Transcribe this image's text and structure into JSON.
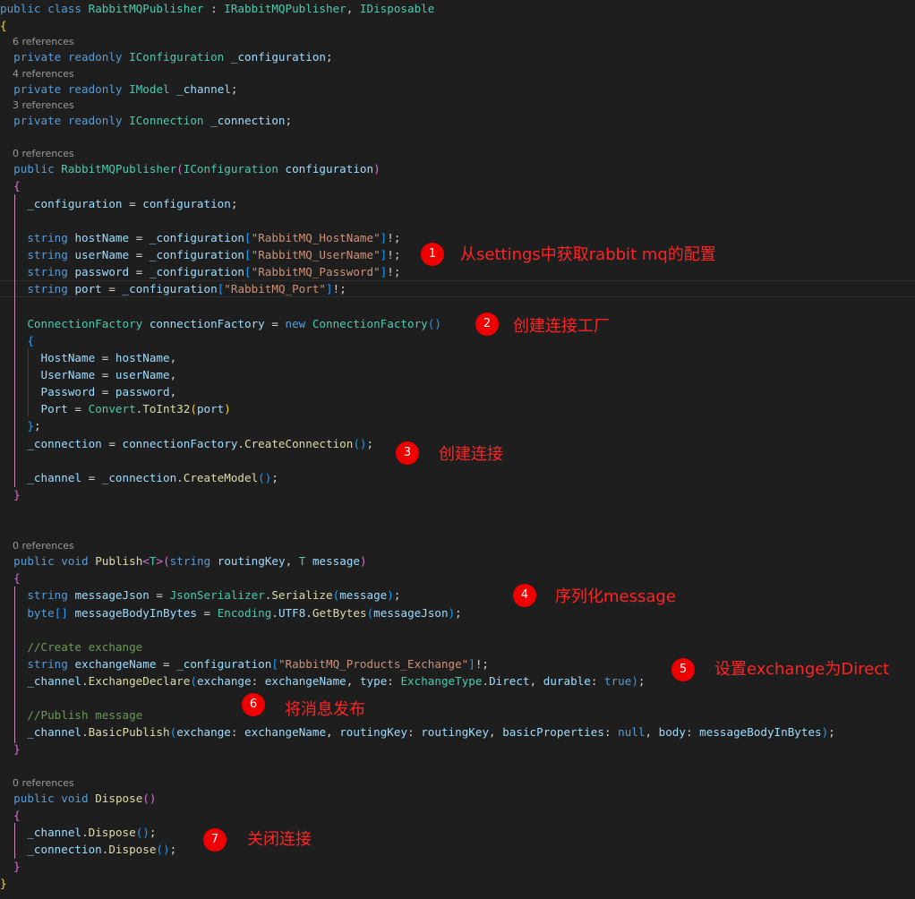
{
  "colors": {
    "background": "#1e1e1e",
    "keyword": "#569cd6",
    "type": "#4ec9b0",
    "method": "#dcdcaa",
    "identifier": "#9cdcfe",
    "string": "#ce9178",
    "comment": "#6a9955",
    "text": "#d4d4d4",
    "bracket_level1": "#ffd700",
    "bracket_level2": "#da70d6",
    "bracket_level3": "#179fff",
    "codelens": "#999999",
    "annotation": "#ff2424",
    "badge": "#ee0000"
  },
  "codelens": {
    "configuration_refs": "6 references",
    "channel_refs": "4 references",
    "connection_refs": "3 references",
    "constructor_refs": "0 references",
    "publish_refs": "0 references",
    "dispose_refs": "0 references"
  },
  "annotations": [
    {
      "number": "1",
      "text": "从settings中获取rabbit mq的配置"
    },
    {
      "number": "2",
      "text": "创建连接工厂"
    },
    {
      "number": "3",
      "text": "创建连接"
    },
    {
      "number": "4",
      "text": "序列化message"
    },
    {
      "number": "5",
      "text": "设置exchange为Direct"
    },
    {
      "number": "6",
      "text": "将消息发布"
    },
    {
      "number": "7",
      "text": "关闭连接"
    }
  ],
  "code_lines": [
    [
      [
        "kw",
        "public"
      ],
      [
        "pl",
        " "
      ],
      [
        "kw",
        "class"
      ],
      [
        "pl",
        " "
      ],
      [
        "ty",
        "RabbitMQPublisher"
      ],
      [
        "pl",
        " : "
      ],
      [
        "ty",
        "IRabbitMQPublisher"
      ],
      [
        "pl",
        ", "
      ],
      [
        "ty",
        "IDisposable"
      ]
    ],
    [
      [
        "b1",
        "{"
      ]
    ],
    [
      [
        "pl",
        "  "
      ],
      [
        "kw",
        "private"
      ],
      [
        "pl",
        " "
      ],
      [
        "kw",
        "readonly"
      ],
      [
        "pl",
        " "
      ],
      [
        "ty",
        "IConfiguration"
      ],
      [
        "pl",
        " "
      ],
      [
        "id",
        "_configuration"
      ],
      [
        "pl",
        ";"
      ]
    ],
    [
      [
        "pl",
        "  "
      ],
      [
        "kw",
        "private"
      ],
      [
        "pl",
        " "
      ],
      [
        "kw",
        "readonly"
      ],
      [
        "pl",
        " "
      ],
      [
        "ty",
        "IModel"
      ],
      [
        "pl",
        " "
      ],
      [
        "id",
        "_channel"
      ],
      [
        "pl",
        ";"
      ]
    ],
    [
      [
        "pl",
        "  "
      ],
      [
        "kw",
        "private"
      ],
      [
        "pl",
        " "
      ],
      [
        "kw",
        "readonly"
      ],
      [
        "pl",
        " "
      ],
      [
        "ty",
        "IConnection"
      ],
      [
        "pl",
        " "
      ],
      [
        "id",
        "_connection"
      ],
      [
        "pl",
        ";"
      ]
    ],
    [
      [
        "pl",
        "  "
      ],
      [
        "kw",
        "public"
      ],
      [
        "pl",
        " "
      ],
      [
        "ty",
        "RabbitMQPublisher"
      ],
      [
        "b2",
        "("
      ],
      [
        "ty",
        "IConfiguration"
      ],
      [
        "pl",
        " "
      ],
      [
        "id",
        "configuration"
      ],
      [
        "b2",
        ")"
      ]
    ],
    [
      [
        "pl",
        "  "
      ],
      [
        "b2",
        "{"
      ]
    ],
    [
      [
        "pl",
        "    "
      ],
      [
        "id",
        "_configuration"
      ],
      [
        "pl",
        " = "
      ],
      [
        "id",
        "configuration"
      ],
      [
        "pl",
        ";"
      ]
    ],
    [
      [
        "pl",
        "    "
      ],
      [
        "kw",
        "string"
      ],
      [
        "pl",
        " "
      ],
      [
        "id",
        "hostName"
      ],
      [
        "pl",
        " = "
      ],
      [
        "id",
        "_configuration"
      ],
      [
        "b3",
        "["
      ],
      [
        "st",
        "\"RabbitMQ_HostName\""
      ],
      [
        "b3",
        "]"
      ],
      [
        "pl",
        "!;"
      ]
    ],
    [
      [
        "pl",
        "    "
      ],
      [
        "kw",
        "string"
      ],
      [
        "pl",
        " "
      ],
      [
        "id",
        "userName"
      ],
      [
        "pl",
        " = "
      ],
      [
        "id",
        "_configuration"
      ],
      [
        "b3",
        "["
      ],
      [
        "st",
        "\"RabbitMQ_UserName\""
      ],
      [
        "b3",
        "]"
      ],
      [
        "pl",
        "!;"
      ]
    ],
    [
      [
        "pl",
        "    "
      ],
      [
        "kw",
        "string"
      ],
      [
        "pl",
        " "
      ],
      [
        "id",
        "password"
      ],
      [
        "pl",
        " = "
      ],
      [
        "id",
        "_configuration"
      ],
      [
        "b3",
        "["
      ],
      [
        "st",
        "\"RabbitMQ_Password\""
      ],
      [
        "b3",
        "]"
      ],
      [
        "pl",
        "!;"
      ]
    ],
    [
      [
        "pl",
        "    "
      ],
      [
        "kw",
        "string"
      ],
      [
        "pl",
        " "
      ],
      [
        "id",
        "port"
      ],
      [
        "pl",
        " = "
      ],
      [
        "id",
        "_configuration"
      ],
      [
        "b3",
        "["
      ],
      [
        "st",
        "\"RabbitMQ_Port\""
      ],
      [
        "b3",
        "]"
      ],
      [
        "pl",
        "!;"
      ]
    ],
    [
      [
        "pl",
        "    "
      ],
      [
        "ty",
        "ConnectionFactory"
      ],
      [
        "pl",
        " "
      ],
      [
        "id",
        "connectionFactory"
      ],
      [
        "pl",
        " = "
      ],
      [
        "kw",
        "new"
      ],
      [
        "pl",
        " "
      ],
      [
        "ty",
        "ConnectionFactory"
      ],
      [
        "b3",
        "()"
      ]
    ],
    [
      [
        "pl",
        "    "
      ],
      [
        "b3",
        "{"
      ]
    ],
    [
      [
        "pl",
        "      "
      ],
      [
        "id",
        "HostName"
      ],
      [
        "pl",
        " = "
      ],
      [
        "id",
        "hostName"
      ],
      [
        "pl",
        ","
      ]
    ],
    [
      [
        "pl",
        "      "
      ],
      [
        "id",
        "UserName"
      ],
      [
        "pl",
        " = "
      ],
      [
        "id",
        "userName"
      ],
      [
        "pl",
        ","
      ]
    ],
    [
      [
        "pl",
        "      "
      ],
      [
        "id",
        "Password"
      ],
      [
        "pl",
        " = "
      ],
      [
        "id",
        "password"
      ],
      [
        "pl",
        ","
      ]
    ],
    [
      [
        "pl",
        "      "
      ],
      [
        "id",
        "Port"
      ],
      [
        "pl",
        " = "
      ],
      [
        "ty",
        "Convert"
      ],
      [
        "pl",
        "."
      ],
      [
        "fn",
        "ToInt32"
      ],
      [
        "b1",
        "("
      ],
      [
        "id",
        "port"
      ],
      [
        "b1",
        ")"
      ]
    ],
    [
      [
        "pl",
        "    "
      ],
      [
        "b3",
        "}"
      ],
      [
        "pl",
        ";"
      ]
    ],
    [
      [
        "pl",
        "    "
      ],
      [
        "id",
        "_connection"
      ],
      [
        "pl",
        " = "
      ],
      [
        "id",
        "connectionFactory"
      ],
      [
        "pl",
        "."
      ],
      [
        "fn",
        "CreateConnection"
      ],
      [
        "b3",
        "()"
      ],
      [
        "pl",
        ";"
      ]
    ],
    [
      [
        "pl",
        "    "
      ],
      [
        "id",
        "_channel"
      ],
      [
        "pl",
        " = "
      ],
      [
        "id",
        "_connection"
      ],
      [
        "pl",
        "."
      ],
      [
        "fn",
        "CreateModel"
      ],
      [
        "b3",
        "()"
      ],
      [
        "pl",
        ";"
      ]
    ],
    [
      [
        "pl",
        "  "
      ],
      [
        "b2",
        "}"
      ]
    ],
    [
      [
        "pl",
        "  "
      ],
      [
        "kw",
        "public"
      ],
      [
        "pl",
        " "
      ],
      [
        "kw",
        "void"
      ],
      [
        "pl",
        " "
      ],
      [
        "fn",
        "Publish"
      ],
      [
        "b2",
        "<"
      ],
      [
        "ty",
        "T"
      ],
      [
        "b2",
        ">"
      ],
      [
        "b2",
        "("
      ],
      [
        "kw",
        "string"
      ],
      [
        "pl",
        " "
      ],
      [
        "id",
        "routingKey"
      ],
      [
        "pl",
        ", "
      ],
      [
        "ty",
        "T"
      ],
      [
        "pl",
        " "
      ],
      [
        "id",
        "message"
      ],
      [
        "b2",
        ")"
      ]
    ],
    [
      [
        "pl",
        "  "
      ],
      [
        "b2",
        "{"
      ]
    ],
    [
      [
        "pl",
        "    "
      ],
      [
        "kw",
        "string"
      ],
      [
        "pl",
        " "
      ],
      [
        "id",
        "messageJson"
      ],
      [
        "pl",
        " = "
      ],
      [
        "ty",
        "JsonSerializer"
      ],
      [
        "pl",
        "."
      ],
      [
        "fn",
        "Serialize"
      ],
      [
        "b3",
        "("
      ],
      [
        "id",
        "message"
      ],
      [
        "b3",
        ")"
      ],
      [
        "pl",
        ";"
      ]
    ],
    [
      [
        "pl",
        "    "
      ],
      [
        "kw",
        "byte"
      ],
      [
        "b3",
        "[]"
      ],
      [
        "pl",
        " "
      ],
      [
        "id",
        "messageBodyInBytes"
      ],
      [
        "pl",
        " = "
      ],
      [
        "ty",
        "Encoding"
      ],
      [
        "pl",
        "."
      ],
      [
        "id",
        "UTF8"
      ],
      [
        "pl",
        "."
      ],
      [
        "fn",
        "GetBytes"
      ],
      [
        "b3",
        "("
      ],
      [
        "id",
        "messageJson"
      ],
      [
        "b3",
        ")"
      ],
      [
        "pl",
        ";"
      ]
    ],
    [
      [
        "pl",
        "    "
      ],
      [
        "cm",
        "//Create exchange"
      ]
    ],
    [
      [
        "pl",
        "    "
      ],
      [
        "kw",
        "string"
      ],
      [
        "pl",
        " "
      ],
      [
        "id",
        "exchangeName"
      ],
      [
        "pl",
        " = "
      ],
      [
        "id",
        "_configuration"
      ],
      [
        "b3",
        "["
      ],
      [
        "st",
        "\"RabbitMQ_Products_Exchange\""
      ],
      [
        "b3",
        "]"
      ],
      [
        "pl",
        "!;"
      ]
    ],
    [
      [
        "pl",
        "    "
      ],
      [
        "id",
        "_channel"
      ],
      [
        "pl",
        "."
      ],
      [
        "fn",
        "ExchangeDeclare"
      ],
      [
        "b3",
        "("
      ],
      [
        "id",
        "exchange"
      ],
      [
        "pl",
        ": "
      ],
      [
        "id",
        "exchangeName"
      ],
      [
        "pl",
        ", "
      ],
      [
        "id",
        "type"
      ],
      [
        "pl",
        ": "
      ],
      [
        "ty",
        "ExchangeType"
      ],
      [
        "pl",
        "."
      ],
      [
        "id",
        "Direct"
      ],
      [
        "pl",
        ", "
      ],
      [
        "id",
        "durable"
      ],
      [
        "pl",
        ": "
      ],
      [
        "kw",
        "true"
      ],
      [
        "b3",
        ")"
      ],
      [
        "pl",
        ";"
      ]
    ],
    [
      [
        "pl",
        "    "
      ],
      [
        "cm",
        "//Publish message"
      ]
    ],
    [
      [
        "pl",
        "    "
      ],
      [
        "id",
        "_channel"
      ],
      [
        "pl",
        "."
      ],
      [
        "fn",
        "BasicPublish"
      ],
      [
        "b3",
        "("
      ],
      [
        "id",
        "exchange"
      ],
      [
        "pl",
        ": "
      ],
      [
        "id",
        "exchangeName"
      ],
      [
        "pl",
        ", "
      ],
      [
        "id",
        "routingKey"
      ],
      [
        "pl",
        ": "
      ],
      [
        "id",
        "routingKey"
      ],
      [
        "pl",
        ", "
      ],
      [
        "id",
        "basicProperties"
      ],
      [
        "pl",
        ": "
      ],
      [
        "kw",
        "null"
      ],
      [
        "pl",
        ", "
      ],
      [
        "id",
        "body"
      ],
      [
        "pl",
        ": "
      ],
      [
        "id",
        "messageBodyInBytes"
      ],
      [
        "b3",
        ")"
      ],
      [
        "pl",
        ";"
      ]
    ],
    [
      [
        "pl",
        "  "
      ],
      [
        "b2",
        "}"
      ]
    ],
    [
      [
        "pl",
        "  "
      ],
      [
        "kw",
        "public"
      ],
      [
        "pl",
        " "
      ],
      [
        "kw",
        "void"
      ],
      [
        "pl",
        " "
      ],
      [
        "fn",
        "Dispose"
      ],
      [
        "b2",
        "()"
      ]
    ],
    [
      [
        "pl",
        "  "
      ],
      [
        "b2",
        "{"
      ]
    ],
    [
      [
        "pl",
        "    "
      ],
      [
        "id",
        "_channel"
      ],
      [
        "pl",
        "."
      ],
      [
        "fn",
        "Dispose"
      ],
      [
        "b3",
        "()"
      ],
      [
        "pl",
        ";"
      ]
    ],
    [
      [
        "pl",
        "    "
      ],
      [
        "id",
        "_connection"
      ],
      [
        "pl",
        "."
      ],
      [
        "fn",
        "Dispose"
      ],
      [
        "b3",
        "()"
      ],
      [
        "pl",
        ";"
      ]
    ],
    [
      [
        "pl",
        "  "
      ],
      [
        "b2",
        "}"
      ]
    ],
    [
      [
        "b1",
        "}"
      ]
    ]
  ]
}
